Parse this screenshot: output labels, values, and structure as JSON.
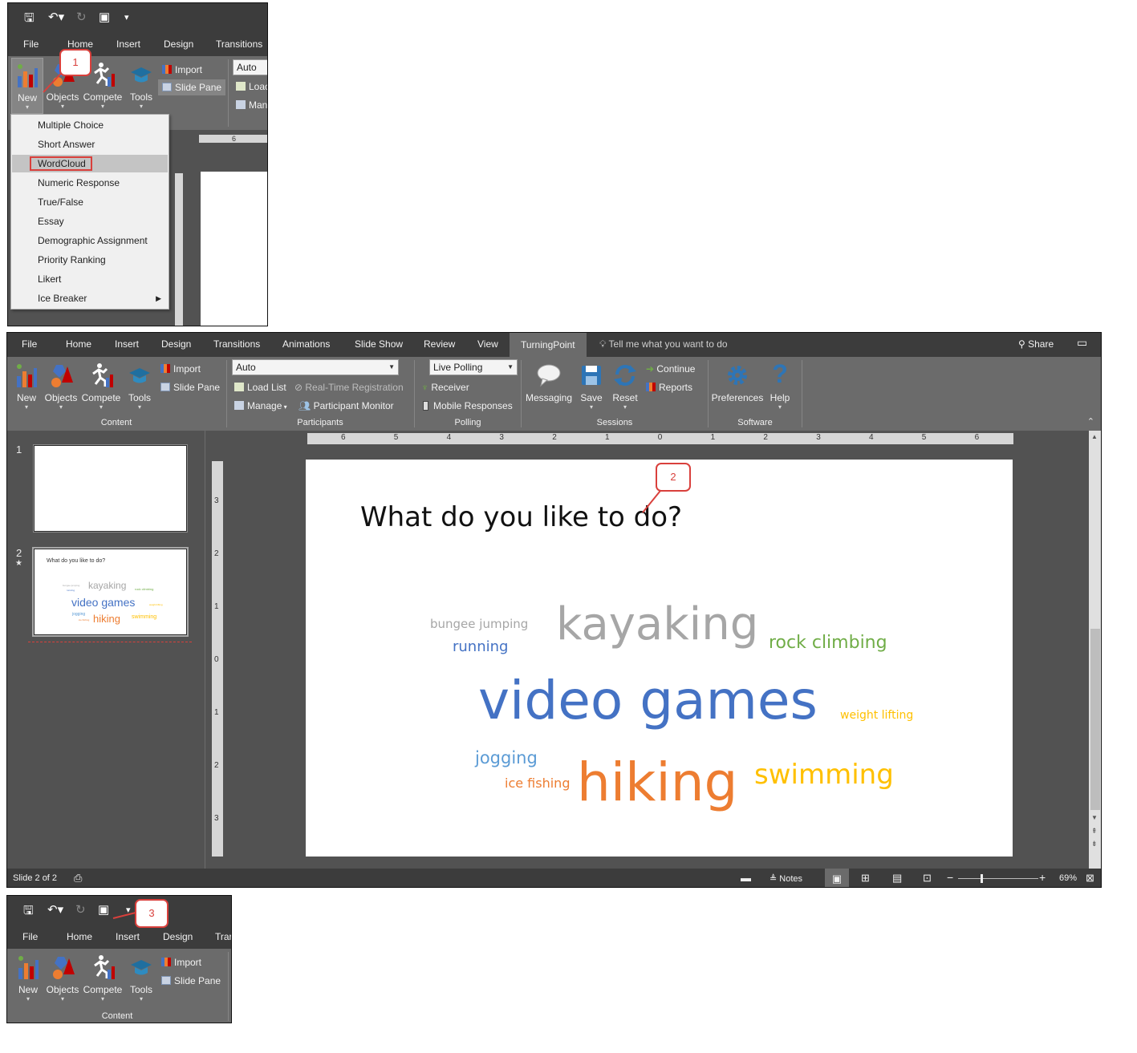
{
  "qat": {
    "save": "🖫",
    "undo": "↶▾",
    "redo": "↻",
    "start": "▣",
    "more": "▾"
  },
  "ribbon_tabs": [
    "File",
    "Home",
    "Insert",
    "Design",
    "Transitions",
    "Animations",
    "Slide Show",
    "Review",
    "View",
    "TurningPoint"
  ],
  "tell_me": "Tell me what you want to do",
  "share": "Share",
  "content_group": {
    "new": "New",
    "objects": "Objects",
    "compete": "Compete",
    "tools": "Tools",
    "import": "Import",
    "slide_pane": "Slide Pane",
    "label": "Content"
  },
  "participants_group": {
    "auto": "Auto",
    "load_list": "Load List",
    "realtime": "Real-Time Registration",
    "manage": "Manage",
    "monitor": "Participant Monitor",
    "label": "Participants",
    "load_clip": "Loac",
    "manage_clip": "Man"
  },
  "polling_group": {
    "live_polling": "Live Polling",
    "receiver": "Receiver",
    "mobile": "Mobile Responses",
    "label": "Polling"
  },
  "sessions_group": {
    "messaging": "Messaging",
    "save": "Save",
    "reset": "Reset",
    "continue": "Continue",
    "reports": "Reports",
    "label": "Sessions"
  },
  "software_group": {
    "preferences": "Preferences",
    "help": "Help",
    "label": "Software"
  },
  "new_menu": [
    "Multiple Choice",
    "Short Answer",
    "WordCloud",
    "Numeric Response",
    "True/False",
    "Essay",
    "Demographic Assignment",
    "Priority Ranking",
    "Likert",
    "Ice Breaker"
  ],
  "callouts": [
    "1",
    "2",
    "3"
  ],
  "slides_panel": {
    "slide1": "1",
    "slide2": "2",
    "star": "★"
  },
  "thumb2": {
    "title": "What do you like to do?",
    "words": [
      "bungee jumping",
      "kayaking",
      "rock climbing",
      "running",
      "video games",
      "weight lifting",
      "jogging",
      "ice fishing",
      "hiking",
      "swimming"
    ]
  },
  "slide": {
    "title": "What do you like to do?"
  },
  "wordcloud": [
    {
      "text": "bungee jumping",
      "color": "#a6a6a6",
      "weight": 15
    },
    {
      "text": "kayaking",
      "color": "#a6a6a6",
      "weight": 56
    },
    {
      "text": "rock climbing",
      "color": "#70ad47",
      "weight": 22
    },
    {
      "text": "running",
      "color": "#4472c4",
      "weight": 18
    },
    {
      "text": "video games",
      "color": "#4472c4",
      "weight": 66
    },
    {
      "text": "weight lifting",
      "color": "#ffc000",
      "weight": 14
    },
    {
      "text": "jogging",
      "color": "#5b9bd5",
      "weight": 21
    },
    {
      "text": "ice fishing",
      "color": "#ed7d31",
      "weight": 16
    },
    {
      "text": "hiking",
      "color": "#ed7d31",
      "weight": 66
    },
    {
      "text": "swimming",
      "color": "#ffc000",
      "weight": 34
    }
  ],
  "ruler_h": [
    "6",
    "5",
    "4",
    "3",
    "2",
    "1",
    "0",
    "1",
    "2",
    "3",
    "4",
    "5",
    "6"
  ],
  "ruler_v": [
    "3",
    "2",
    "1",
    "0",
    "1",
    "2",
    "3"
  ],
  "status": {
    "slide_of": "Slide 2 of 2",
    "notes": "Notes",
    "zoom": "69%"
  },
  "colors": {
    "ribbon": "#6b6b6b",
    "titlebar": "#3c3c3c",
    "workspace": "#525252",
    "accent": "#d9403c"
  }
}
